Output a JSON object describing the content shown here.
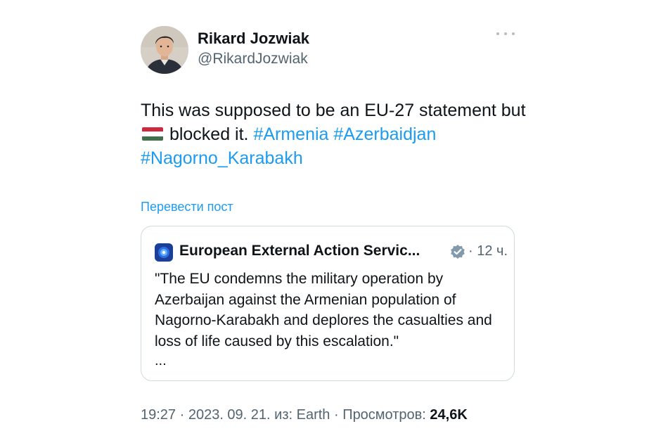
{
  "author": {
    "display_name": "Rikard Jozwiak",
    "handle": "@RikardJozwiak"
  },
  "more_icon": "more-horizontal-icon",
  "tweet": {
    "text_before_flag": "This was supposed to be an EU-27 statement but ",
    "flag_icon": "hungary-flag-icon",
    "text_after_flag": " blocked it. ",
    "hashtags": [
      "#Armenia",
      "#Azerbaidjan",
      "#Nagorno_Karabakh"
    ]
  },
  "translate_label": "Перевести пост",
  "quoted_post": {
    "author_name": "European External Action Servic...",
    "verified_icon": "verified-badge-icon",
    "time": "· 12 ч.",
    "text": "\"The EU condemns the military operation by Azerbaijan against the Armenian population of Nagorno-Karabakh and deplores the casualties and loss of life caused by this escalation.\"",
    "ellipsis": "..."
  },
  "meta": {
    "timestamp": "19:27 · 2023. 09. 21.",
    "source": " из: Earth · ",
    "views_label": "Просмотров: ",
    "views_value": "24,6K"
  },
  "colors": {
    "link": "#1d9bf0",
    "secondary_text": "#536471",
    "primary_text": "#0f1419",
    "border": "#cfd9de"
  }
}
